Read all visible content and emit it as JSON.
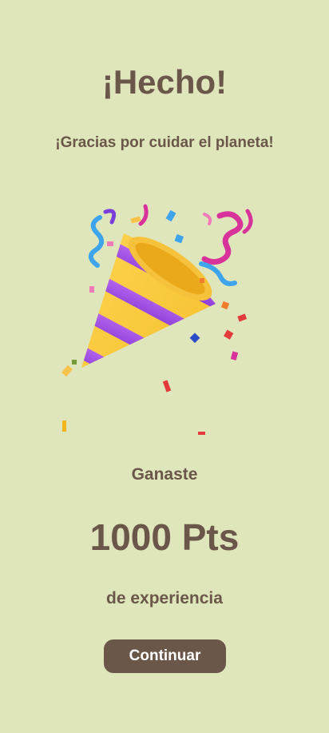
{
  "header": {
    "title": "¡Hecho!",
    "subtitle": "¡Gracias por cuidar el planeta!"
  },
  "illustration": {
    "icon": "party-popper-icon"
  },
  "reward": {
    "earned_label": "Ganaste",
    "points": "1000 Pts",
    "experience_label": "de experiencia"
  },
  "actions": {
    "continue_label": "Continuar"
  },
  "colors": {
    "background": "#e0e6bb",
    "text": "#6a5749",
    "button": "#6a5749",
    "button_text": "#ffffff"
  }
}
